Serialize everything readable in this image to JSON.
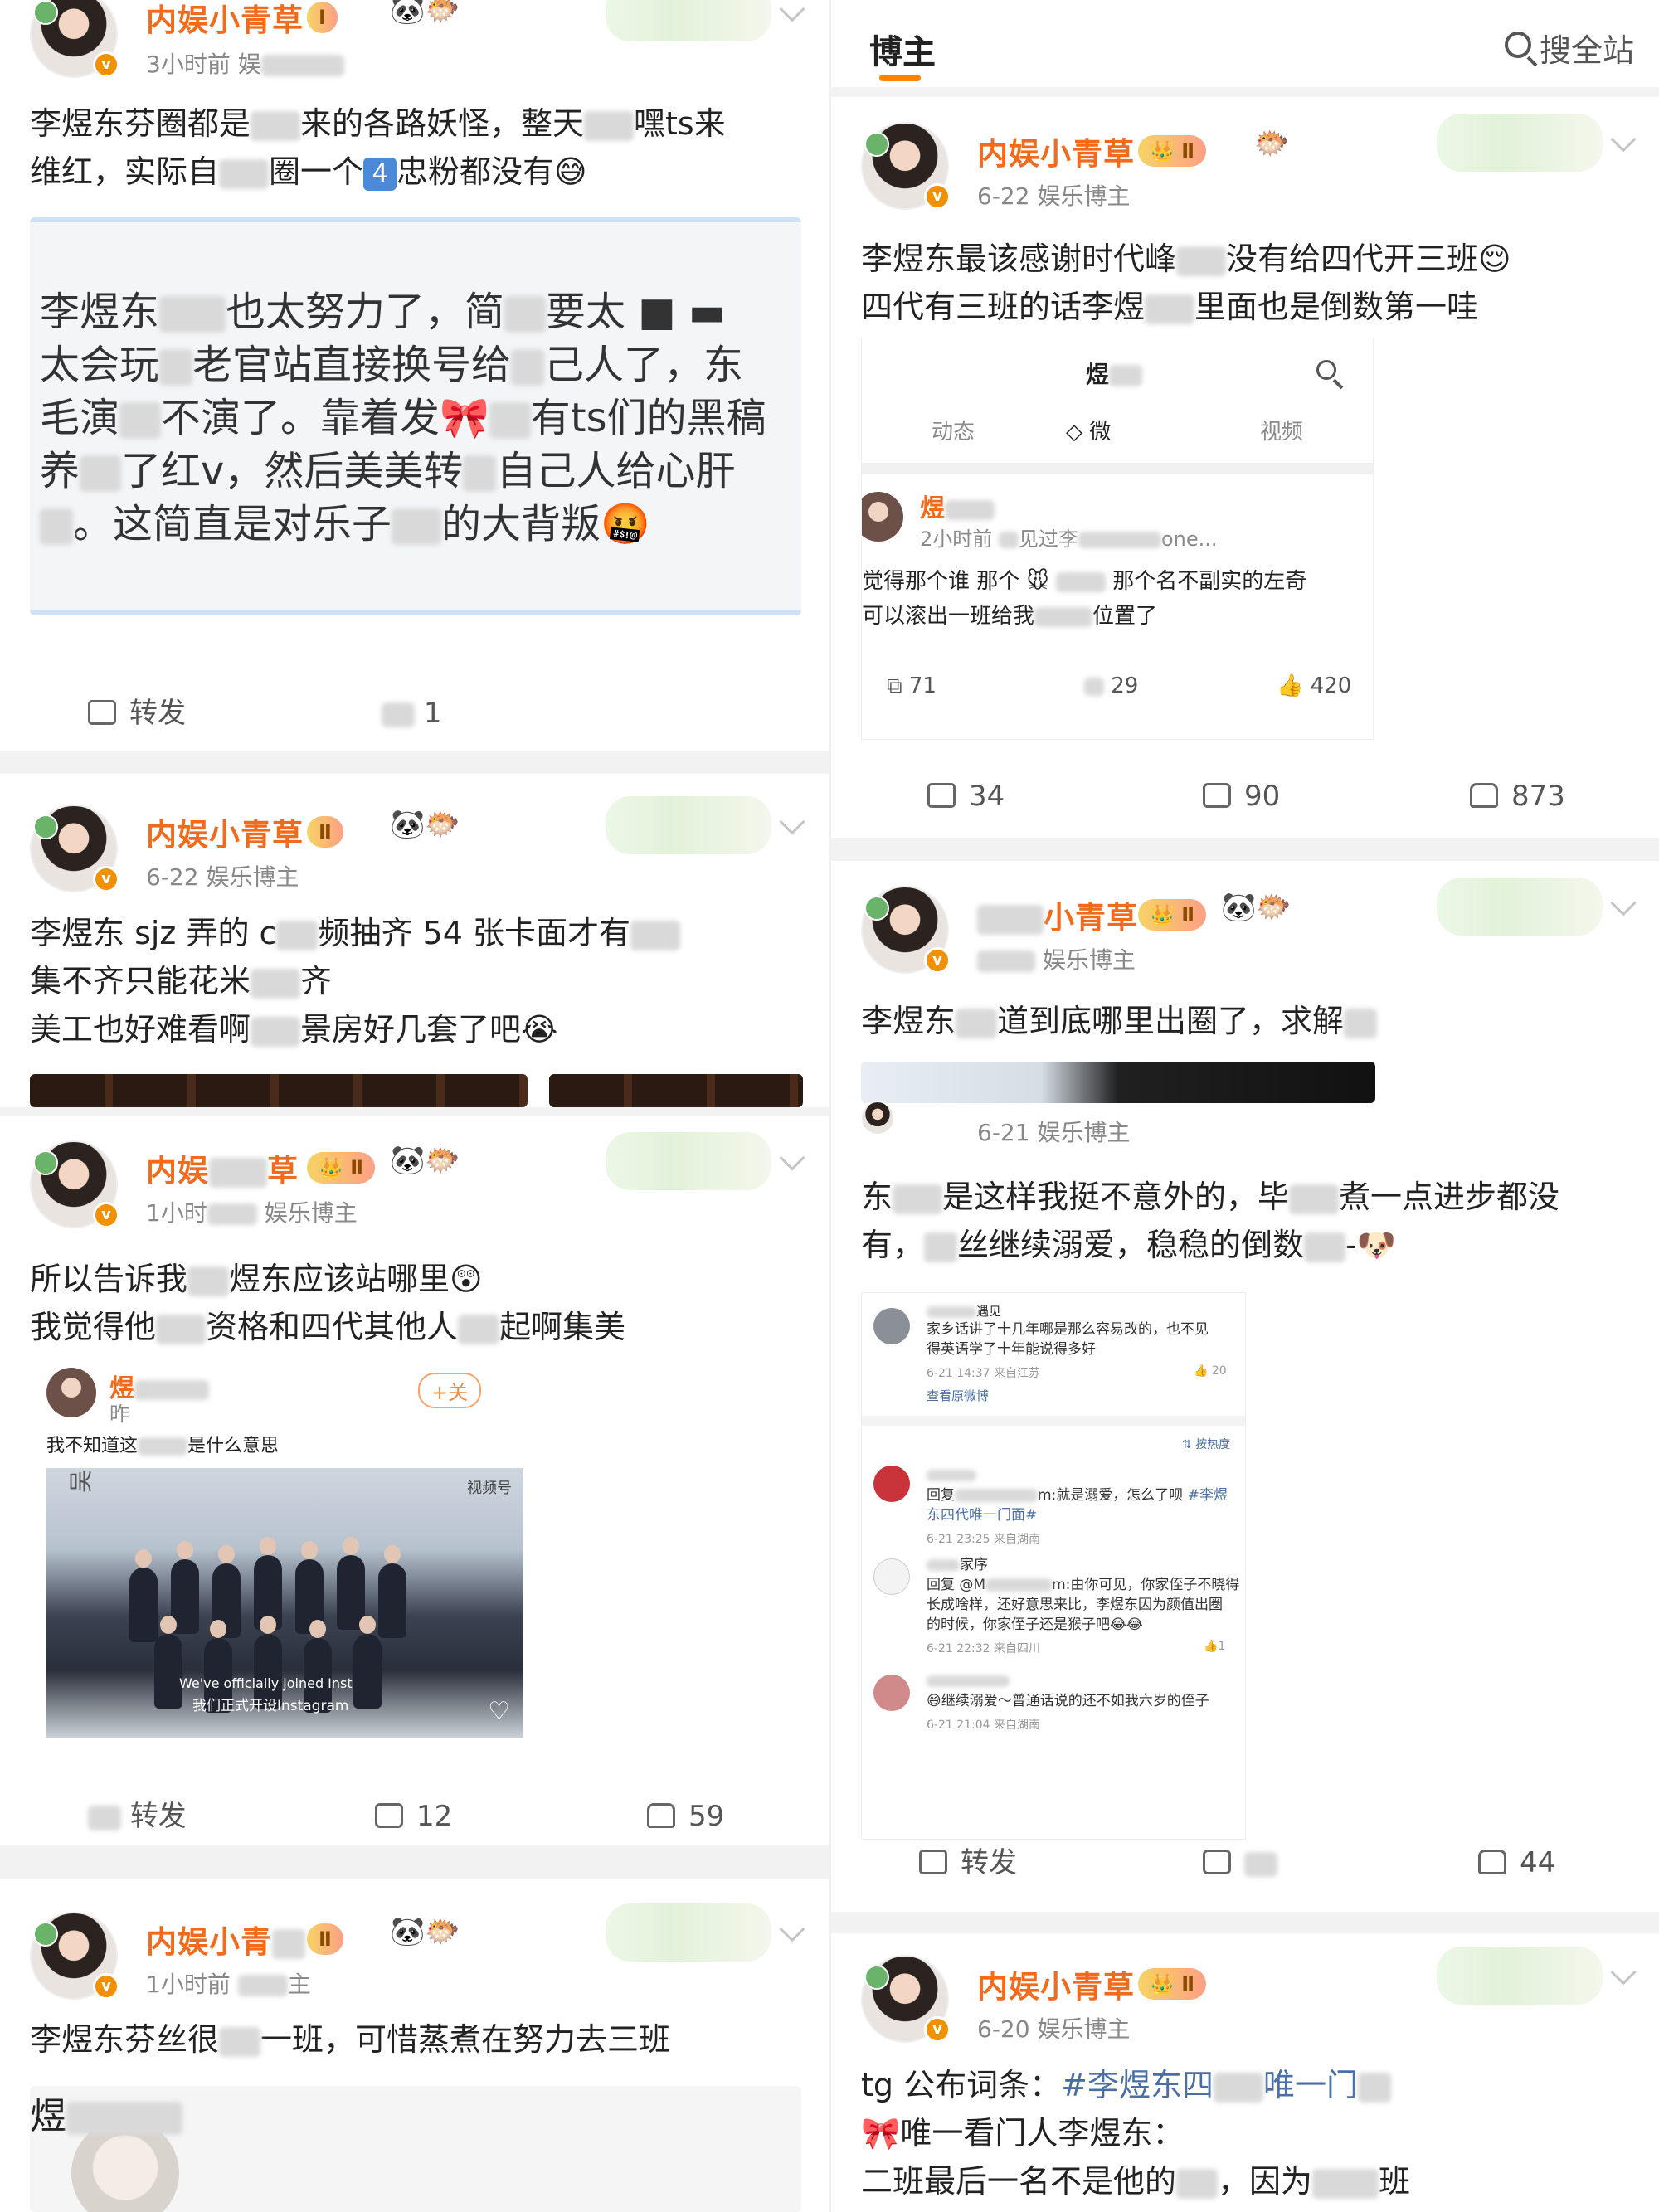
{
  "left": {
    "posts": [
      {
        "name": "内娱小青草",
        "time": "3小时前",
        "source": "娱",
        "text1": "李煜东芬圈都是",
        "text1b": "来的各路妖怪，整天",
        "text1c": "嘿ts来",
        "text2": "维红，实际自",
        "text2b": "圈一个",
        "text2num": "4",
        "text2c": "忠粉都没有",
        "quote_lines": [
          "李煜东",
          "太会玩",
          "毛演",
          "养",
          "这简直是对乐子"
        ],
        "quote_l1b": "也太努力了，简",
        "quote_l1c": "要太",
        "quote_l2b": "老官站直接换号给",
        "quote_l2c": "己人了，东",
        "quote_l3b": "不演了。靠着发",
        "quote_l3c": "有ts们的黑稿",
        "quote_l4b": "了红v，然后美美转",
        "quote_l4c": "自己人给心肝",
        "quote_l5b": "的大背叛",
        "repost": "转发",
        "comments": "1"
      },
      {
        "name": "内娱小青草",
        "time": "6-22",
        "source": "娱乐博主",
        "line1a": "李煜东 sjz 弄的 c",
        "line1b": "频抽齐 54 张卡面才有",
        "line2a": "集不齐只能花米",
        "line2b": "齐",
        "line3a": "美工也好难看啊",
        "line3b": "景房好几套了吧"
      },
      {
        "name": "内娱",
        "name2": "草",
        "time": "1小时",
        "source": "娱乐博主",
        "line1a": "所以告诉我",
        "line1b": "煜东应该站哪里",
        "line2a": "我觉得他",
        "line2b": "资格和四代其他人",
        "line2c": "起啊集美",
        "inner_name": "煜",
        "inner_time": "昨",
        "inner_follow": "+关",
        "inner_text": "我不知道这",
        "inner_text2": "是什么意思",
        "photo_caption1": "We've officially joined Inst",
        "photo_caption2": "我们正式开设Instagram",
        "photo_tag": "视频号",
        "repost": "转发",
        "comments": "12",
        "likes": "59"
      },
      {
        "name": "内娱小青",
        "time": "1小时前",
        "source": "主",
        "line1a": "李煜东芬丝很",
        "line1b": "一班，可惜蒸煮在努力去三班",
        "inner_name": "煜"
      }
    ]
  },
  "right": {
    "header": {
      "tab": "博主",
      "search": "搜全站"
    },
    "posts": [
      {
        "name": "内娱小青草",
        "time": "6-22",
        "source": "娱乐博主",
        "line1a": "李煜东最该感谢时代峰",
        "line1b": "没有给四代开三班",
        "line2a": "四代有三班的话李煜",
        "line2b": "里面也是倒数第一哇",
        "inner_title": "煜",
        "inner_tabs": [
          "动态",
          "微",
          "视频"
        ],
        "inner_name": "煜",
        "inner_time": "2小时前",
        "inner_meta2": "见过李",
        "inner_meta3": "one...",
        "inner_text1a": "觉得那个谁 那个",
        "inner_text1b": "那个名不副实的左奇",
        "inner_text2a": "可以滚出一班给我",
        "inner_text2b": "位置了",
        "inner_repost": "71",
        "inner_comments": "29",
        "inner_likes": "420",
        "repost": "34",
        "comments": "90",
        "likes": "873"
      },
      {
        "name": "小青草",
        "time": "",
        "source": "娱乐博主",
        "line1a": "李煜东",
        "line1b": "道到底哪里出圈了，求解",
        "sub_time": "6-21",
        "sub_source": "娱乐博主",
        "sub_line1a": "东",
        "sub_line1b": "是这样我挺不意外的，毕",
        "sub_line1c": "煮一点进步都没",
        "sub_line2a": "有，",
        "sub_line2b": "丝继续溺爱，稳稳的倒数",
        "sub_line2c": "-",
        "c1_name": "遇见",
        "c1_text1": "家乡话讲了十几年哪是那么容易改的，也不见",
        "c1_text2": "得英语学了十年能说得多好",
        "c1_meta": "6-21 14:37 来自江苏",
        "c1_likes": "20",
        "c1_link": "查看原微博",
        "sort_label": "按热度",
        "c2_text1a": "回复",
        "c2_text1b": "m:就是溺爱，怎么了呗",
        "c2_tag": "#李煜",
        "c2_text2": "东四代唯一门面#",
        "c2_meta": "6-21 23:25 来自湖南",
        "c3_name": "家序",
        "c3_text1a": "回复 @M",
        "c3_text1b": "m:由你可见，你家侄子不晓得",
        "c3_text2": "长成啥样，还好意思来比，李煜东因为颜值出圈",
        "c3_text3": "的时候，你家侄子还是猴子吧",
        "c3_meta": "6-21 22:32 来自四川",
        "c3_likes": "1",
        "c4_text": "继续溺爱～普通话说的还不如我六岁的侄子",
        "c4_meta": "6-21 21:04 来自湖南",
        "repost": "转发",
        "likes": "44"
      },
      {
        "name": "内娱小青草",
        "time": "6-20",
        "source": "娱乐博主",
        "line1a": "tg 公布词条：",
        "line1tag": "#李煜东四",
        "line1tag2": "唯一门",
        "line2": "唯一看门人李煜东：",
        "line3a": "二班最后一名不是他的",
        "line3b": "，因为",
        "line3c": "班"
      }
    ]
  },
  "colors": {
    "accent": "#ff8200",
    "name": "#f26b1d",
    "hashtag": "#4a6fa5"
  }
}
